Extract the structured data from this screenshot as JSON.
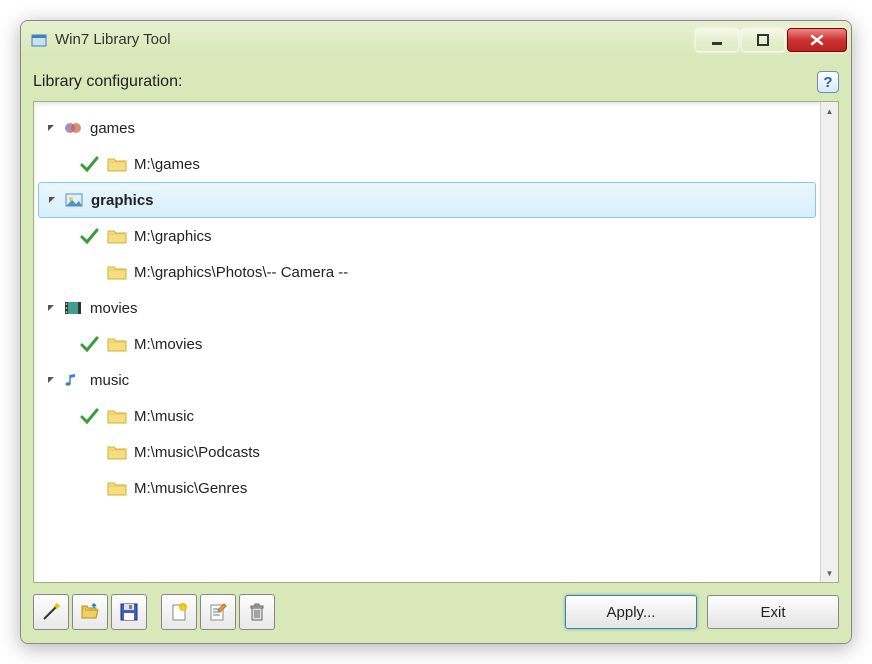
{
  "window": {
    "title": "Win7 Library Tool"
  },
  "header": {
    "label": "Library configuration:"
  },
  "tree": [
    {
      "type": "library",
      "label": "games",
      "icon": "games-icon",
      "expanded": true,
      "selected": false,
      "bold": false
    },
    {
      "type": "folder",
      "label": "M:\\games",
      "check": true,
      "indent": 1
    },
    {
      "type": "library",
      "label": "graphics",
      "icon": "graphics-icon",
      "expanded": true,
      "selected": true,
      "bold": true
    },
    {
      "type": "folder",
      "label": "M:\\graphics",
      "check": true,
      "indent": 1
    },
    {
      "type": "folder",
      "label": "M:\\graphics\\Photos\\-- Camera --",
      "check": false,
      "indent": 1
    },
    {
      "type": "library",
      "label": "movies",
      "icon": "movies-icon",
      "expanded": true,
      "selected": false,
      "bold": false
    },
    {
      "type": "folder",
      "label": "M:\\movies",
      "check": true,
      "indent": 1
    },
    {
      "type": "library",
      "label": "music",
      "icon": "music-icon",
      "expanded": true,
      "selected": false,
      "bold": false
    },
    {
      "type": "folder",
      "label": "M:\\music",
      "check": true,
      "indent": 1
    },
    {
      "type": "folder",
      "label": "M:\\music\\Podcasts",
      "check": false,
      "indent": 1
    },
    {
      "type": "folder",
      "label": "M:\\music\\Genres",
      "check": false,
      "indent": 1
    }
  ],
  "buttons": {
    "apply": "Apply...",
    "exit": "Exit"
  },
  "toolbar": {
    "wizard": "wizard",
    "open": "open",
    "save": "save",
    "new": "new-library",
    "edit": "edit-library",
    "delete": "delete"
  }
}
